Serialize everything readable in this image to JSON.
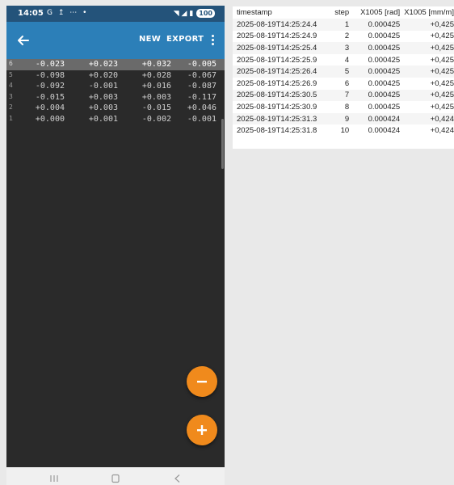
{
  "status_bar": {
    "time": "14:05",
    "left_icons": "G ↥ ⋯ •",
    "right_icons": "◥ ◢ ▮",
    "battery": "100"
  },
  "appbar": {
    "new_label": "NEW",
    "export_label": "EXPORT"
  },
  "grid": {
    "rows": [
      {
        "idx": "6",
        "selected": true,
        "values": [
          "-0.023",
          "+0.023",
          "+0.032",
          "-0.005"
        ]
      },
      {
        "idx": "5",
        "selected": false,
        "values": [
          "-0.098",
          "+0.020",
          "+0.028",
          "-0.067"
        ]
      },
      {
        "idx": "4",
        "selected": false,
        "values": [
          "-0.092",
          "-0.001",
          "+0.016",
          "-0.087"
        ]
      },
      {
        "idx": "3",
        "selected": false,
        "values": [
          "-0.015",
          "+0.003",
          "+0.003",
          "-0.117"
        ]
      },
      {
        "idx": "2",
        "selected": false,
        "values": [
          "+0.004",
          "+0.003",
          "-0.015",
          "+0.046"
        ]
      },
      {
        "idx": "1",
        "selected": false,
        "values": [
          "+0.000",
          "+0.001",
          "-0.002",
          "-0.001"
        ]
      }
    ]
  },
  "fab": {
    "minus_label": "−",
    "plus_label": "+"
  },
  "table": {
    "headers": [
      "timestamp",
      "step",
      "X1005 [rad]",
      "X1005 [mm/m]"
    ],
    "rows": [
      [
        "2025-08-19T14:25:24.4",
        "1",
        "0.000425",
        "+0,425"
      ],
      [
        "2025-08-19T14:25:24.9",
        "2",
        "0.000425",
        "+0,425"
      ],
      [
        "2025-08-19T14:25:25.4",
        "3",
        "0.000425",
        "+0,425"
      ],
      [
        "2025-08-19T14:25:25.9",
        "4",
        "0.000425",
        "+0,425"
      ],
      [
        "2025-08-19T14:25:26.4",
        "5",
        "0.000425",
        "+0,425"
      ],
      [
        "2025-08-19T14:25:26.9",
        "6",
        "0.000425",
        "+0,425"
      ],
      [
        "2025-08-19T14:25:30.5",
        "7",
        "0.000425",
        "+0,425"
      ],
      [
        "2025-08-19T14:25:30.9",
        "8",
        "0.000425",
        "+0,425"
      ],
      [
        "2025-08-19T14:25:31.3",
        "9",
        "0.000424",
        "+0,424"
      ],
      [
        "2025-08-19T14:25:31.8",
        "10",
        "0.000424",
        "+0,424"
      ]
    ]
  },
  "colors": {
    "appbar": "#2c7fb8",
    "statusbar": "#24537a",
    "fab": "#f08a1c",
    "grid_bg": "#2a2a2a",
    "selected_row": "#6a6a6a"
  }
}
